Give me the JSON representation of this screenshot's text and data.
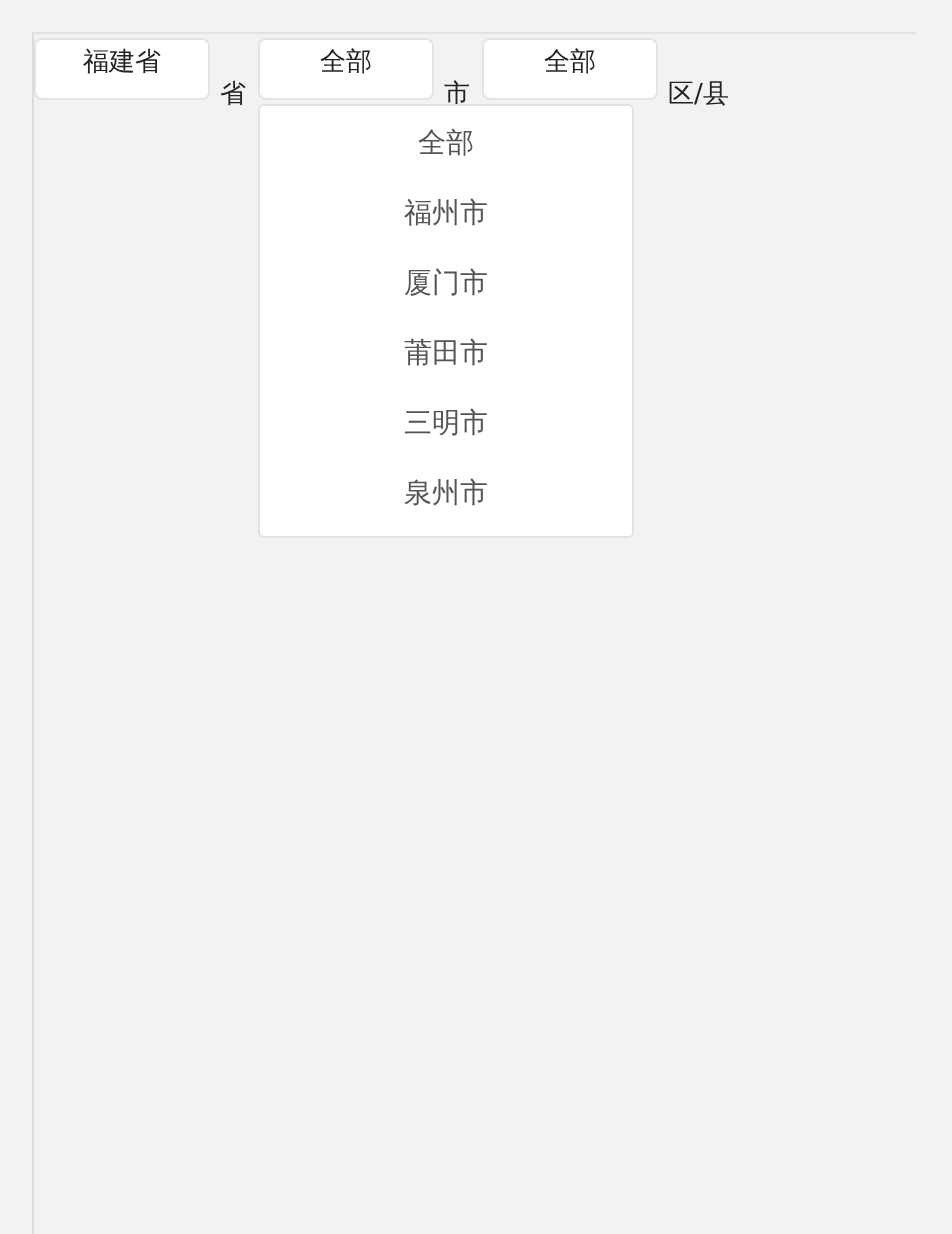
{
  "selects": [
    {
      "value": "福建省",
      "unit": "省"
    },
    {
      "value": "全部",
      "unit": "市",
      "options": [
        "全部",
        "福州市",
        "厦门市",
        "莆田市",
        "三明市",
        "泉州市"
      ]
    },
    {
      "value": "全部",
      "unit": "区/县"
    }
  ]
}
